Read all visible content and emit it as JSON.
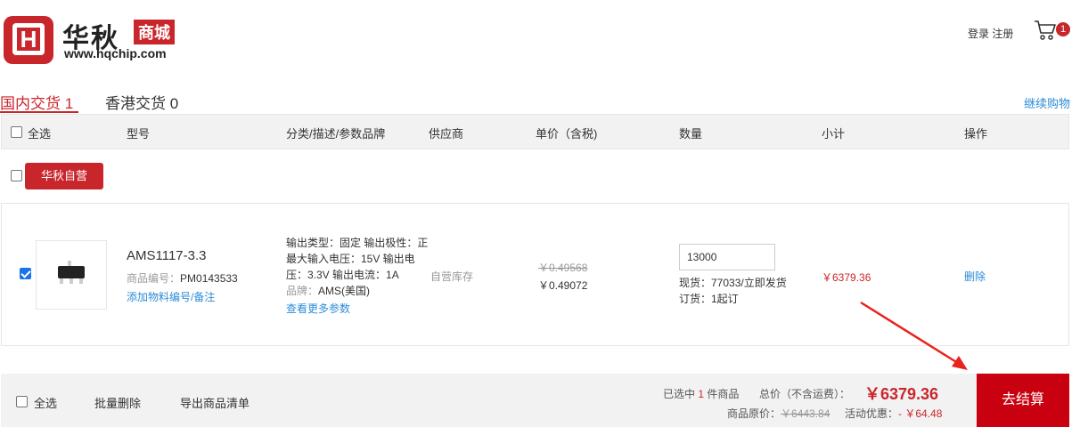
{
  "header": {
    "logo_letter": "H",
    "brand_cn": "华秋",
    "brand_badge": "商城",
    "brand_url": "www.hqchip.com",
    "login_label": "登录",
    "register_label": "注册",
    "cart_count": "1"
  },
  "tabs": [
    {
      "label": "国内交货 1",
      "active": true
    },
    {
      "label": "香港交货 0",
      "active": false
    }
  ],
  "continue_shopping": "继续购物",
  "table_header": {
    "select_all": "全选",
    "model": "型号",
    "category": "分类/描述/参数品牌",
    "supplier": "供应商",
    "unit_price": "单价（含税)",
    "quantity": "数量",
    "subtotal": "小计",
    "actions": "操作"
  },
  "store_group": {
    "label": "华秋自营",
    "checked": false
  },
  "item": {
    "checked": true,
    "model": "AMS1117-3.3",
    "part_no_label": "商品编号：",
    "part_no": "PM0143533",
    "add_note": "添加物料编号/备注",
    "description": "输出类型：固定 输出极性：正 最大输入电压：15V 输出电压：3.3V 输出电流：1A",
    "brand_label": "品牌：",
    "brand": "AMS(美国)",
    "more_params": "查看更多参数",
    "supplier": "自营库存",
    "price_old": "￥0.49568",
    "price_new": "￥0.49072",
    "quantity": "13000",
    "stock": "现货：77033/立即发货",
    "min_order": "订货：1起订",
    "subtotal": "￥6379.36",
    "delete": "删除"
  },
  "footer": {
    "select_all": "全选",
    "batch_delete": "批量删除",
    "export": "导出商品清单",
    "selected_prefix": "已选中",
    "selected_count": "1",
    "selected_suffix": "件商品",
    "total_label": "总价（不含运费）：",
    "total": "￥6379.36",
    "original_label": "商品原价：",
    "original": "￥6443.84",
    "discount_label": "活动优惠：",
    "discount": "- ￥64.48",
    "checkout": "去结算"
  },
  "colors": {
    "brand_red": "#c9262c",
    "checkout_red": "#c9000f",
    "link_blue": "#2d8cd8",
    "header_bg": "#f2f2f2"
  },
  "icons": [
    "cart-icon",
    "checkbox-icon",
    "arrow-icon"
  ]
}
